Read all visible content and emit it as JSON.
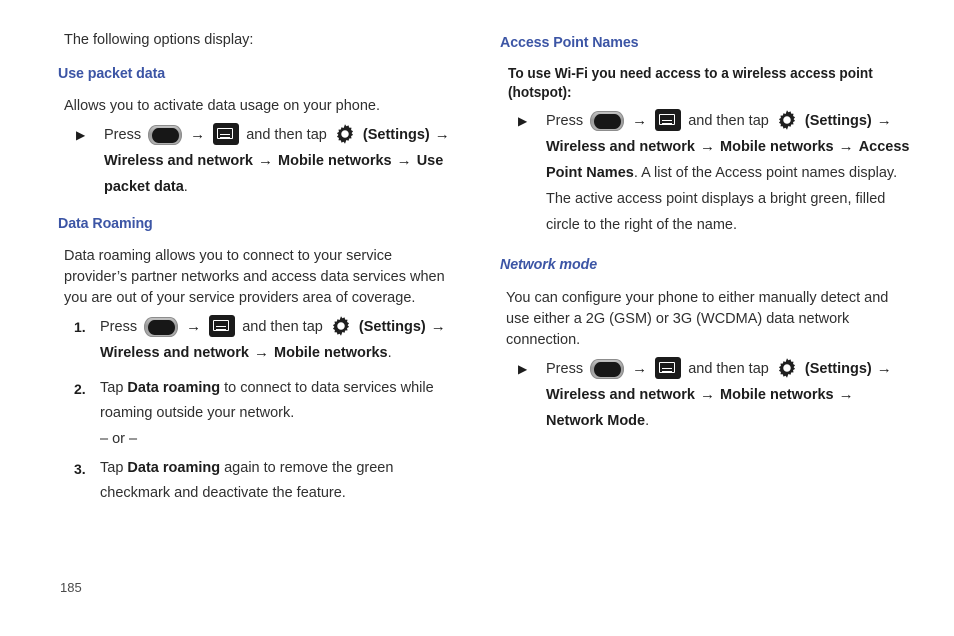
{
  "page": {
    "number": "185"
  },
  "icons": {
    "home_key": "home-key-icon",
    "menu_key": "menu-key-icon",
    "settings_gear": "settings-gear-icon",
    "arrow": "→",
    "bullet": "▶"
  },
  "colors": {
    "heading_blue": "#3c55a5",
    "body_text": "#2f2f2f",
    "icon_black": "#1b1b1b"
  },
  "left_column": {
    "intro": "The following options display:",
    "section_use_packet_data": {
      "heading": "Use packet data",
      "body": "Allows you to activate data usage on your phone.",
      "step": {
        "marker": "▶",
        "press_label": "Press",
        "and_then_tap": "and then tap",
        "settings_paren": "(Settings)",
        "path_1": "Wireless and network",
        "path_2": "Mobile networks",
        "path_3": "Use packet data",
        "period": "."
      }
    },
    "section_data_roaming": {
      "heading": "Data Roaming",
      "body": "Data roaming allows you to connect to your service provider’s partner networks and access data services when you are out of your service providers area of coverage.",
      "step1": {
        "marker": "1.",
        "press_label": "Press",
        "and_then_tap": "and then tap",
        "settings_paren": "(Settings)",
        "path_1": "Wireless and network",
        "path_2": "Mobile networks",
        "period": "."
      },
      "step2": {
        "marker": "2.",
        "lead": "Tap ",
        "bold": "Data roaming",
        "rest": " to connect to data services while roaming outside your network."
      },
      "or_line": "– or –",
      "step3": {
        "marker": "3.",
        "lead": "Tap ",
        "bold": "Data roaming",
        "rest": " again to remove the green checkmark and deactivate the feature."
      }
    }
  },
  "right_column": {
    "section_access_point_names": {
      "heading": "Access Point Names",
      "subheading": "To use Wi-Fi you need access to a wireless access point (hotspot):",
      "step": {
        "marker": "▶",
        "press_label": "Press",
        "and_then_tap": "and then tap",
        "settings_paren": "(Settings)",
        "path_1": "Wireless and network",
        "path_2": "Mobile networks",
        "path_3": "Access Point Names",
        "trailing": ". A list of the Access point names display. The active access point displays a bright green, filled circle to the right of the name."
      }
    },
    "section_network_mode": {
      "heading": "Network mode",
      "body": "You can configure your phone to either manually detect and use either a 2G (GSM) or 3G (WCDMA) data network connection.",
      "step": {
        "marker": "▶",
        "press_label": "Press",
        "and_then_tap": "and then tap",
        "settings_paren": "(Settings)",
        "path_1": "Wireless and network",
        "path_2": "Mobile networks",
        "path_3": "Network Mode",
        "period": "."
      }
    }
  }
}
